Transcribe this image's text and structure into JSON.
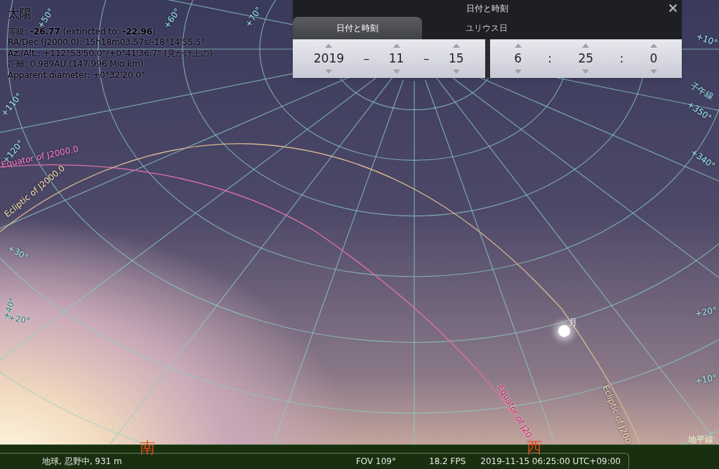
{
  "info": {
    "title": "太陽",
    "lines": [
      "等級: **-26.77** (extincted to: **-22.96**)",
      "RA/Dec (J2000.0): 15h18m03.57s/-18°14'55.5\"",
      "Az./Alt.: +112°53'50.0\"/+0°41'36.7\" (見かけ上の)",
      "距離: 0.989AU (147.996 Mio km)",
      "Apparent diameter: +0°32'20.0\""
    ]
  },
  "sky_labels": [
    {
      "text": "+50°"
    },
    {
      "text": "+60°"
    },
    {
      "text": "+70°"
    },
    {
      "text": "+110°"
    },
    {
      "text": "+120°"
    },
    {
      "text": "+30°"
    },
    {
      "text": "+40°"
    },
    {
      "text": "+20°"
    },
    {
      "text": "+10°"
    },
    {
      "text": "子午線"
    },
    {
      "text": "+350°"
    },
    {
      "text": "+340°"
    },
    {
      "text": "+20°"
    },
    {
      "text": "+10°"
    }
  ],
  "line_labels": [
    {
      "kind": "equator",
      "text": "Equator of J2000.0"
    },
    {
      "kind": "ecliptic",
      "text": "Ecliptic of J2000.0"
    },
    {
      "kind": "equator",
      "text": "Equator of J20"
    },
    {
      "kind": "ecliptic",
      "text": "Ecliptic of J200"
    }
  ],
  "moon": {
    "label": "月"
  },
  "compass": [
    {
      "text": "南"
    },
    {
      "text": "西"
    }
  ],
  "horizon_label": "地平線",
  "dialog": {
    "title": "日付と時刻",
    "tabs": [
      {
        "label": "日付と時刻",
        "selected": true
      },
      {
        "label": "ユリウス日",
        "selected": false
      }
    ],
    "date_parts": [
      {
        "kind": "field",
        "value": "2019"
      },
      {
        "kind": "separator",
        "value": "–"
      },
      {
        "kind": "field",
        "value": "11"
      },
      {
        "kind": "separator",
        "value": "–"
      },
      {
        "kind": "field",
        "value": "15"
      }
    ],
    "time_parts": [
      {
        "kind": "field",
        "value": "6"
      },
      {
        "kind": "separator",
        "value": ":"
      },
      {
        "kind": "field",
        "value": "25"
      },
      {
        "kind": "separator",
        "value": ":"
      },
      {
        "kind": "field",
        "value": "0"
      }
    ]
  },
  "status_bar": {
    "location": "地球, 忍野中, 931 m",
    "fov": "FOV 109°",
    "fps": "18.2 FPS",
    "datetime": "2019-11-15 06:25:00 UTC+09:00"
  }
}
